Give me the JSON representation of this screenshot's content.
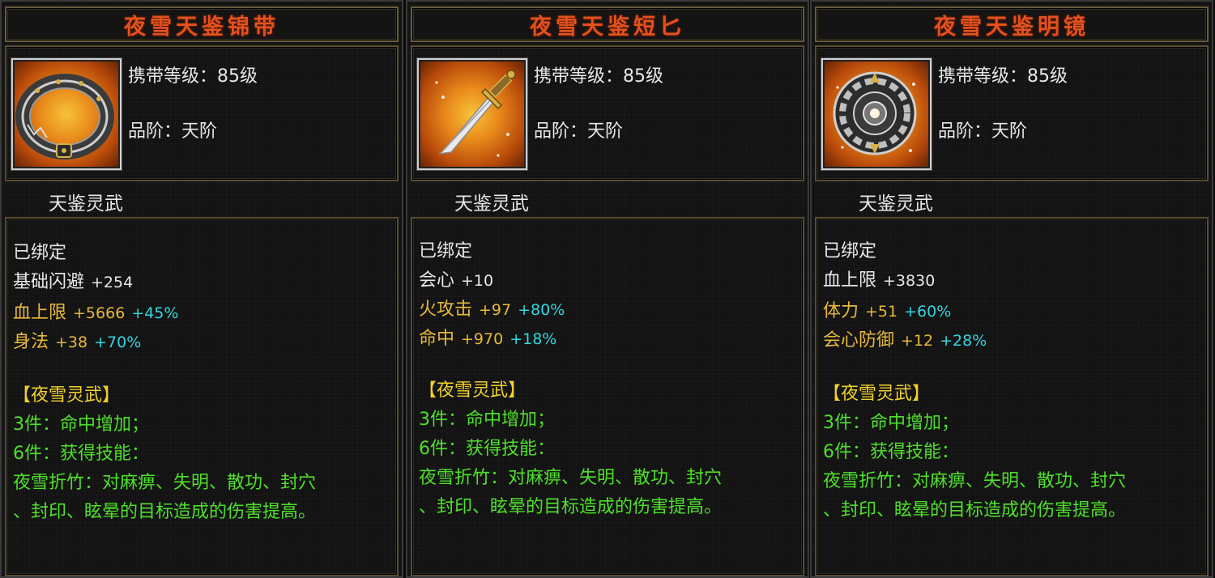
{
  "colors": {
    "title": "#e2521e",
    "white": "#e8e8e8",
    "stat_gold": "#e8b93a",
    "percent_cyan": "#33d6e0",
    "set_green": "#4ee02a",
    "set_title_yellow": "#f1d22a",
    "border": "#5a4c30"
  },
  "cards": [
    {
      "title": "夜雪天鉴锦带",
      "icon": "belt-icon",
      "level": "携带等级：85级",
      "grade": "品阶：天阶",
      "set_name": "天鉴灵武",
      "bound": "已绑定",
      "stats": [
        {
          "name": "基础闪避",
          "value": "+254",
          "percent": "",
          "color": "white"
        },
        {
          "name": "血上限",
          "value": "+5666",
          "percent": "+45%",
          "color": "gold"
        },
        {
          "name": "身法",
          "value": "+38",
          "percent": "+70%",
          "color": "gold"
        }
      ],
      "set_title": "【夜雪灵武】",
      "set_lines": [
        "3件：命中增加；",
        "6件：获得技能：",
        "夜雪折竹：对麻痹、失明、散功、封穴",
        "、封印、眩晕的目标造成的伤害提高。"
      ]
    },
    {
      "title": "夜雪天鉴短匕",
      "icon": "dagger-icon",
      "level": "携带等级：85级",
      "grade": "品阶：天阶",
      "set_name": "天鉴灵武",
      "bound": "已绑定",
      "stats": [
        {
          "name": "会心",
          "value": "+10",
          "percent": "",
          "color": "white"
        },
        {
          "name": "火攻击",
          "value": "+97",
          "percent": "+80%",
          "color": "gold"
        },
        {
          "name": "命中",
          "value": "+970",
          "percent": "+18%",
          "color": "gold"
        }
      ],
      "set_title": "【夜雪灵武】",
      "set_lines": [
        "3件：命中增加；",
        "6件：获得技能：",
        "夜雪折竹：对麻痹、失明、散功、封穴",
        "、封印、眩晕的目标造成的伤害提高。"
      ]
    },
    {
      "title": "夜雪天鉴明镜",
      "icon": "mirror-icon",
      "level": "携带等级：85级",
      "grade": "品阶：天阶",
      "set_name": "天鉴灵武",
      "bound": "已绑定",
      "stats": [
        {
          "name": "血上限",
          "value": "+3830",
          "percent": "",
          "color": "white"
        },
        {
          "name": "体力",
          "value": "+51",
          "percent": "+60%",
          "color": "gold"
        },
        {
          "name": "会心防御",
          "value": "+12",
          "percent": "+28%",
          "color": "gold"
        }
      ],
      "set_title": "【夜雪灵武】",
      "set_lines": [
        "3件：命中增加；",
        "6件：获得技能：",
        "夜雪折竹：对麻痹、失明、散功、封穴",
        "、封印、眩晕的目标造成的伤害提高。"
      ]
    }
  ]
}
